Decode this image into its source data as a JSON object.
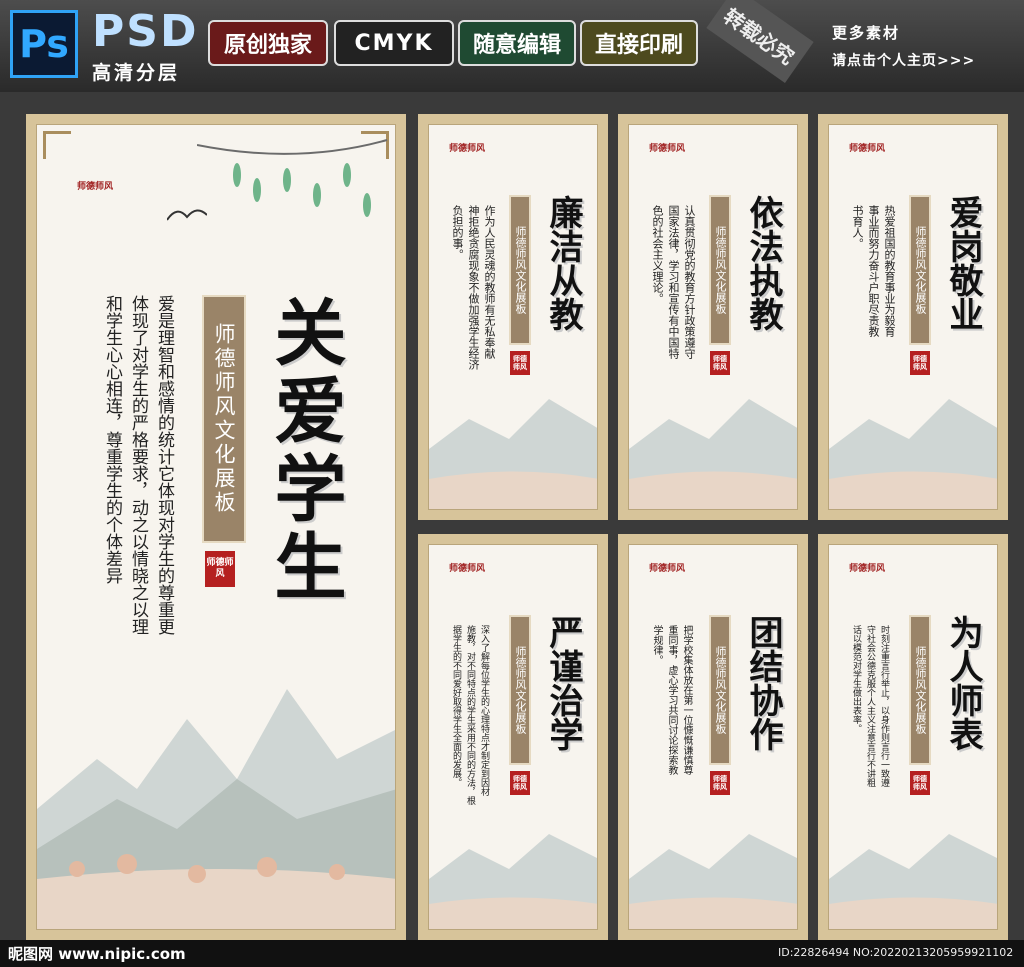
{
  "header": {
    "ps_logo": "Ps",
    "psd": "PSD",
    "psd_sub": "高清分层",
    "tags": [
      "原创独家",
      "CMYK",
      "随意编辑",
      "直接印刷"
    ],
    "ribbon": "转载必究",
    "more_line1": "更多素材",
    "more_line2": "请点击个人主页>>>"
  },
  "common": {
    "banner": "师德师风文化展板",
    "seal": "师德师风",
    "logo": "师德师风"
  },
  "big_panel": {
    "title": "关爱学生",
    "text": [
      "爱是理智和感情的统计它体现对学生的尊重更",
      "体现了对学生的严格要求，动之以情晓之以理",
      "和学生心心相连，尊重学生的个体差异"
    ]
  },
  "panels": [
    {
      "title": "廉洁从教",
      "text": [
        "作为人民灵魂的教师有无私奉献",
        "神拒绝贪腐现象不做加强学生经济",
        "负担的事。"
      ]
    },
    {
      "title": "依法执教",
      "text": [
        "认真贯彻党的教育方针政策遵守",
        "国家法律，学习和宣传有中国特",
        "色的社会主义理论。"
      ]
    },
    {
      "title": "爱岗敬业",
      "text": [
        "热爱祖国的教育事业为毅育",
        "事业而努力奋斗户职尽责教",
        "书育人。"
      ]
    },
    {
      "title": "严谨治学",
      "text": [
        "深入了解每位学生的心理特点才制定到因材",
        "施教，对不同特点的学生采用不同的方法，根",
        "据学生的不同爱好取得学生全面的发展。"
      ]
    },
    {
      "title": "团结协作",
      "text": [
        "把学校集体放在第一位慷慨谦慎尊",
        "重同事，虚心学习共同讨论探索教",
        "学规律。"
      ]
    },
    {
      "title": "为人师表",
      "text": [
        "时刻注重言行举止，以身作则言行一致遵",
        "守社会公德克服个人主义注意言行不讲粗",
        "话以模范对学生做出表率。"
      ]
    }
  ],
  "footer": {
    "watermark": "昵图网 www.nipic.com",
    "id_text": "ID:22826494 NO:20220213205959921102"
  }
}
